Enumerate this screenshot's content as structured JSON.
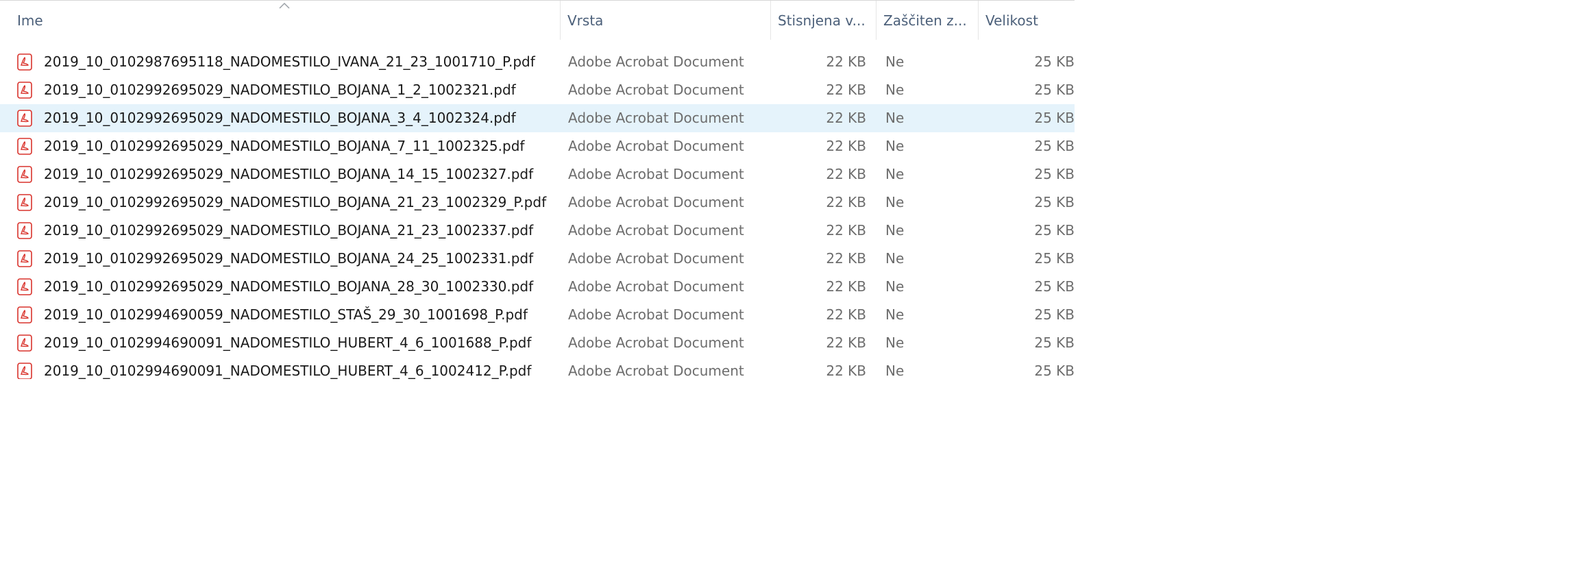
{
  "columns": {
    "name": "Ime",
    "type": "Vrsta",
    "compressed": "Stisnjena v...",
    "protected": "Zaščiten z...",
    "size": "Velikost"
  },
  "icons": {
    "sort": "chevron-up-icon",
    "file": "pdf-file-icon"
  },
  "colors": {
    "pdf_icon": "#d9322b",
    "selected_row": "#e5f3fb",
    "header_text": "#4c607a"
  },
  "files": [
    {
      "name": "2019_10_0102987695118_NADOMESTILO_IVANA_21_23_1001710_P.pdf",
      "type": "Adobe Acrobat Document",
      "compressed": "22 KB",
      "protected": "Ne",
      "size": "25 KB"
    },
    {
      "name": "2019_10_0102992695029_NADOMESTILO_BOJANA_1_2_1002321.pdf",
      "type": "Adobe Acrobat Document",
      "compressed": "22 KB",
      "protected": "Ne",
      "size": "25 KB"
    },
    {
      "name": "2019_10_0102992695029_NADOMESTILO_BOJANA_3_4_1002324.pdf",
      "type": "Adobe Acrobat Document",
      "compressed": "22 KB",
      "protected": "Ne",
      "size": "25 KB"
    },
    {
      "name": "2019_10_0102992695029_NADOMESTILO_BOJANA_7_11_1002325.pdf",
      "type": "Adobe Acrobat Document",
      "compressed": "22 KB",
      "protected": "Ne",
      "size": "25 KB"
    },
    {
      "name": "2019_10_0102992695029_NADOMESTILO_BOJANA_14_15_1002327.pdf",
      "type": "Adobe Acrobat Document",
      "compressed": "22 KB",
      "protected": "Ne",
      "size": "25 KB"
    },
    {
      "name": "2019_10_0102992695029_NADOMESTILO_BOJANA_21_23_1002329_P.pdf",
      "type": "Adobe Acrobat Document",
      "compressed": "22 KB",
      "protected": "Ne",
      "size": "25 KB"
    },
    {
      "name": "2019_10_0102992695029_NADOMESTILO_BOJANA_21_23_1002337.pdf",
      "type": "Adobe Acrobat Document",
      "compressed": "22 KB",
      "protected": "Ne",
      "size": "25 KB"
    },
    {
      "name": "2019_10_0102992695029_NADOMESTILO_BOJANA_24_25_1002331.pdf",
      "type": "Adobe Acrobat Document",
      "compressed": "22 KB",
      "protected": "Ne",
      "size": "25 KB"
    },
    {
      "name": "2019_10_0102992695029_NADOMESTILO_BOJANA_28_30_1002330.pdf",
      "type": "Adobe Acrobat Document",
      "compressed": "22 KB",
      "protected": "Ne",
      "size": "25 KB"
    },
    {
      "name": "2019_10_0102994690059_NADOMESTILO_STAŠ_29_30_1001698_P.pdf",
      "type": "Adobe Acrobat Document",
      "compressed": "22 KB",
      "protected": "Ne",
      "size": "25 KB"
    },
    {
      "name": "2019_10_0102994690091_NADOMESTILO_HUBERT_4_6_1001688_P.pdf",
      "type": "Adobe Acrobat Document",
      "compressed": "22 KB",
      "protected": "Ne",
      "size": "25 KB"
    },
    {
      "name": "2019_10_0102994690091_NADOMESTILO_HUBERT_4_6_1002412_P.pdf",
      "type": "Adobe Acrobat Document",
      "compressed": "22 KB",
      "protected": "Ne",
      "size": "25 KB"
    }
  ],
  "selected_index": 2
}
